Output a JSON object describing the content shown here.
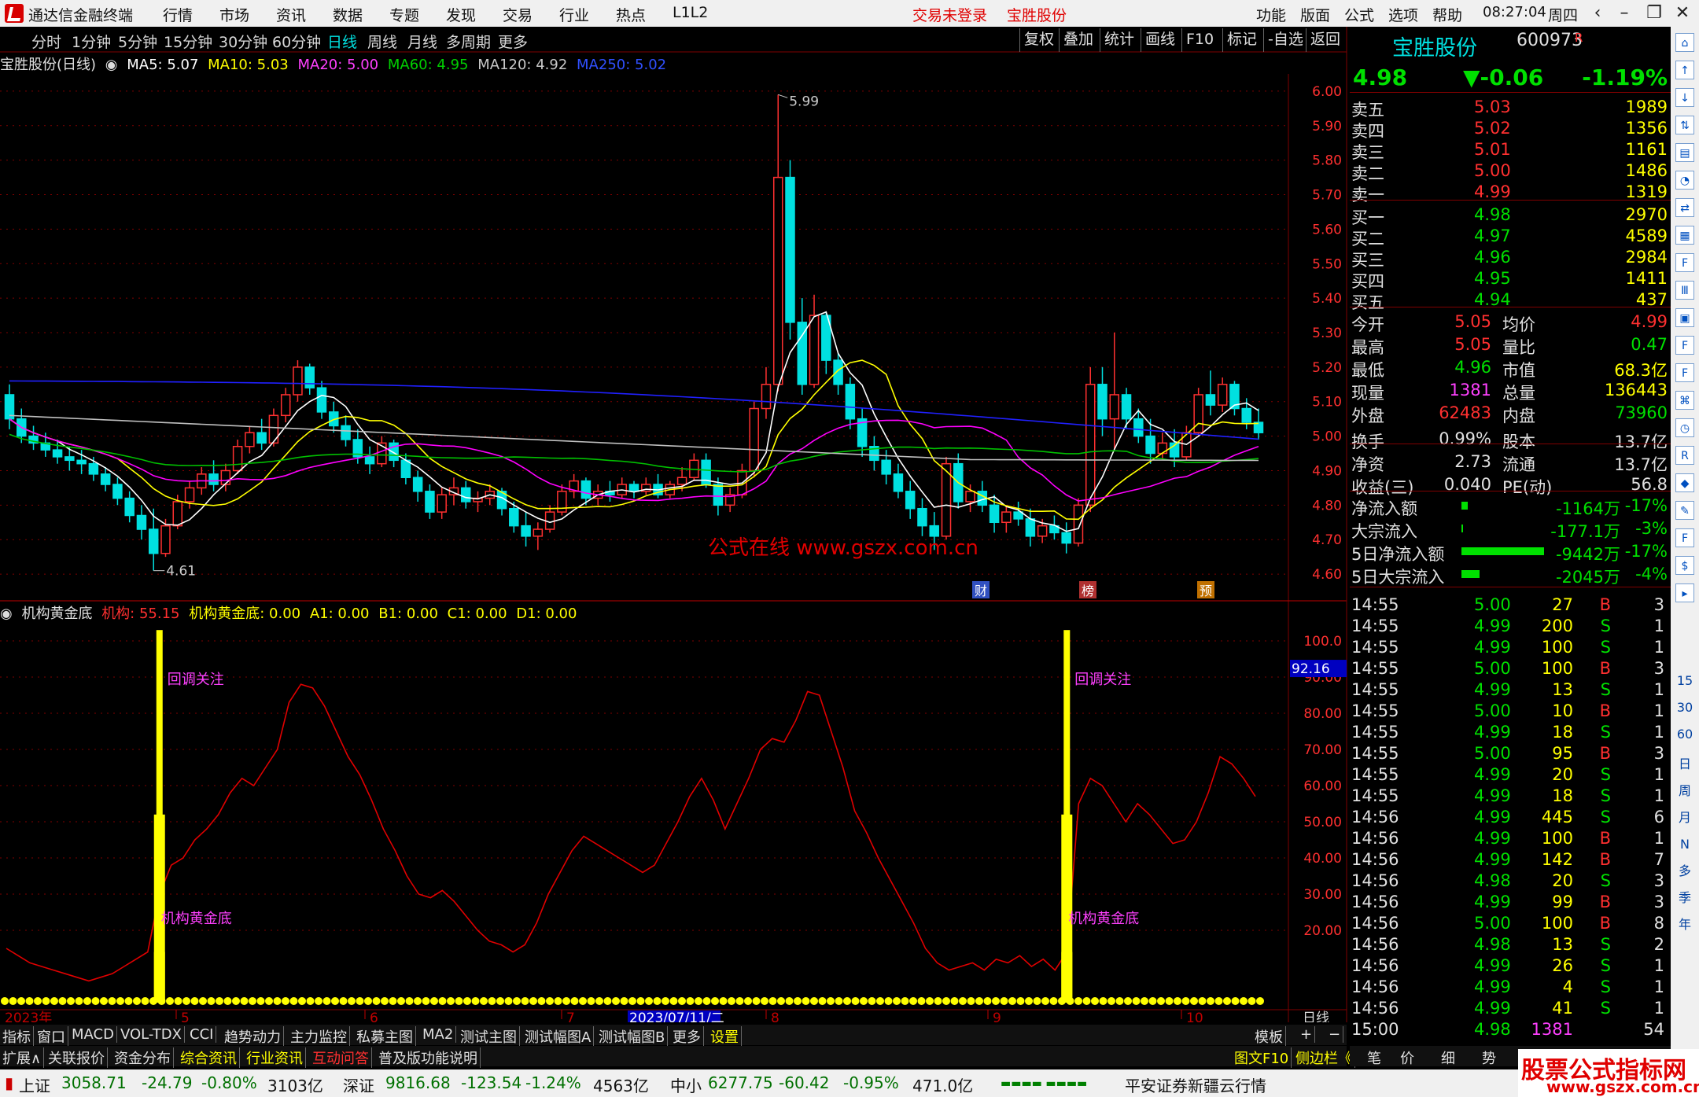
{
  "app": {
    "title": "通达信金融终端",
    "menu": [
      "行情",
      "市场",
      "资讯",
      "数据",
      "专题",
      "发现",
      "交易",
      "行业",
      "热点",
      "L1L2"
    ],
    "login": "交易未登录",
    "stock_link": "宝胜股份",
    "right_menu": [
      "功能",
      "版面",
      "公式",
      "选项",
      "帮助"
    ],
    "time": "08:27:04",
    "weekday": "周四"
  },
  "periods": [
    "分时",
    "1分钟",
    "5分钟",
    "15分钟",
    "30分钟",
    "60分钟",
    "日线",
    "周线",
    "月线",
    "多周期",
    "更多"
  ],
  "active_period": "日线",
  "toolbar": [
    "复权",
    "叠加",
    "统计",
    "画线",
    "F10",
    "标记",
    "-自选",
    "返回"
  ],
  "ma_line": {
    "name": "宝胜股份(日线)",
    "ma5": "MA5: 5.07",
    "ma10": "MA10: 5.03",
    "ma20": "MA20: 5.00",
    "ma60": "MA60: 4.95",
    "ma120": "MA120: 4.92",
    "ma250": "MA250: 5.02"
  },
  "indicator_line": {
    "name": "机构黄金底",
    "jg": "机构: 55.15",
    "jghjd": "机构黄金底: 0.00",
    "a1": "A1: 0.00",
    "b1": "B1: 0.00",
    "c1": "C1: 0.00",
    "d1": "D1: 0.00"
  },
  "colors": {
    "up": "#ff3030",
    "down": "#00e0e0",
    "ma5": "#ffffff",
    "ma10": "#ffff00",
    "ma20": "#ff00ff",
    "ma60": "#00c000",
    "ma120": "#c0c0c0",
    "ma250": "#2020ff",
    "grid": "#800000"
  },
  "price_axis": [
    "6.00",
    "5.90",
    "5.80",
    "5.70",
    "5.60",
    "5.50",
    "5.40",
    "5.30",
    "5.20",
    "5.10",
    "5.00",
    "4.90",
    "4.80",
    "4.70",
    "4.60"
  ],
  "ind_axis": [
    "100.0",
    "90.00",
    "80.00",
    "70.00",
    "60.00",
    "50.00",
    "40.00",
    "30.00",
    "20.00"
  ],
  "ind_cursor": "92.16",
  "hi_label": "5.99",
  "lo_label": "4.61",
  "watermark": "公式在线  www.gszx.com.cn",
  "signals": {
    "callback": "回调关注",
    "bottom": "机构黄金底"
  },
  "event_badges": [
    "财",
    "榜",
    "预"
  ],
  "date_axis": {
    "start": "2023年",
    "months": [
      "5",
      "6",
      "7",
      "8",
      "9",
      "10"
    ],
    "cursor": "2023/07/11/二",
    "period": "日线"
  },
  "quote": {
    "name": "宝胜股份",
    "code": "600973",
    "tag": "R",
    "price": "4.98",
    "change": "▼-0.06",
    "pct": "-1.19%"
  },
  "asks": [
    {
      "l": "卖五",
      "p": "5.03",
      "v": "1989"
    },
    {
      "l": "卖四",
      "p": "5.02",
      "v": "1356"
    },
    {
      "l": "卖三",
      "p": "5.01",
      "v": "1161"
    },
    {
      "l": "卖二",
      "p": "5.00",
      "v": "1486"
    },
    {
      "l": "卖一",
      "p": "4.99",
      "v": "1319"
    }
  ],
  "bids": [
    {
      "l": "买一",
      "p": "4.98",
      "v": "2970"
    },
    {
      "l": "买二",
      "p": "4.97",
      "v": "4589"
    },
    {
      "l": "买三",
      "p": "4.96",
      "v": "2984"
    },
    {
      "l": "买四",
      "p": "4.95",
      "v": "1411"
    },
    {
      "l": "买五",
      "p": "4.94",
      "v": "437"
    }
  ],
  "stats": [
    {
      "l1": "今开",
      "v1": "5.05",
      "l2": "均价",
      "v2": "4.99"
    },
    {
      "l1": "最高",
      "v1": "5.05",
      "l2": "量比",
      "v2": "0.47"
    },
    {
      "l1": "最低",
      "v1": "4.96",
      "l2": "市值",
      "v2": "68.3亿"
    },
    {
      "l1": "现量",
      "v1": "1381",
      "l2": "总量",
      "v2": "136443"
    },
    {
      "l1": "外盘",
      "v1": "62483",
      "l2": "内盘",
      "v2": "73960"
    },
    {
      "l1": "换手",
      "v1": "0.99%",
      "l2": "股本",
      "v2": "13.7亿"
    },
    {
      "l1": "净资",
      "v1": "2.73",
      "l2": "流通",
      "v2": "13.7亿"
    },
    {
      "l1": "收益(三)",
      "v1": "0.040",
      "l2": "PE(动)",
      "v2": "56.8"
    }
  ],
  "flows": [
    {
      "l": "净流入额",
      "v": "-1164万",
      "p": "-17%",
      "bar": 0.04
    },
    {
      "l": "大宗流入",
      "v": "-177.1万",
      "p": "-3%",
      "bar": 0.005
    },
    {
      "l": "5日净流入额",
      "v": "-9442万",
      "p": "-17%",
      "bar": 0.55
    },
    {
      "l": "5日大宗流入",
      "v": "-2045万",
      "p": "-4%",
      "bar": 0.12
    }
  ],
  "ticks": [
    [
      "14:55",
      "5.00",
      "27",
      "B",
      "3"
    ],
    [
      "14:55",
      "4.99",
      "200",
      "S",
      "1"
    ],
    [
      "14:55",
      "4.99",
      "100",
      "S",
      "1"
    ],
    [
      "14:55",
      "5.00",
      "100",
      "B",
      "3"
    ],
    [
      "14:55",
      "4.99",
      "13",
      "S",
      "1"
    ],
    [
      "14:55",
      "5.00",
      "10",
      "B",
      "1"
    ],
    [
      "14:55",
      "4.99",
      "18",
      "S",
      "1"
    ],
    [
      "14:55",
      "5.00",
      "95",
      "B",
      "3"
    ],
    [
      "14:55",
      "4.99",
      "20",
      "S",
      "1"
    ],
    [
      "14:55",
      "4.99",
      "18",
      "S",
      "1"
    ],
    [
      "14:56",
      "4.99",
      "445",
      "S",
      "6"
    ],
    [
      "14:56",
      "4.99",
      "100",
      "B",
      "1"
    ],
    [
      "14:56",
      "4.99",
      "142",
      "B",
      "7"
    ],
    [
      "14:56",
      "4.98",
      "20",
      "S",
      "3"
    ],
    [
      "14:56",
      "4.99",
      "99",
      "B",
      "3"
    ],
    [
      "14:56",
      "5.00",
      "100",
      "B",
      "8"
    ],
    [
      "14:56",
      "4.98",
      "13",
      "S",
      "2"
    ],
    [
      "14:56",
      "4.99",
      "26",
      "S",
      "1"
    ],
    [
      "14:56",
      "4.99",
      "4",
      "S",
      "1"
    ],
    [
      "14:56",
      "4.99",
      "41",
      "S",
      "1"
    ],
    [
      "15:00",
      "4.98",
      "1381",
      "",
      "54"
    ]
  ],
  "ind_tabs": [
    "指标",
    "窗口",
    "MACD",
    "VOL-TDX",
    "CCI",
    "趋势动力",
    "主力监控",
    "私募主图",
    "MA2",
    "测试主图",
    "测试幅图A",
    "测试幅图B",
    "更多",
    "设置"
  ],
  "tabs_right": [
    "模板",
    "+",
    "−"
  ],
  "bottom_tabs": [
    "扩展∧",
    "关联报价",
    "资金分布",
    "综合资讯",
    "行业资讯",
    "互动问答",
    "普及版功能说明"
  ],
  "rbottom": [
    "图文F10",
    "侧边栏《",
    "笔",
    "价",
    "细",
    "势"
  ],
  "status": {
    "sh_name": "上证",
    "sh_val": "3058.71",
    "sh_chg": "-24.79",
    "sh_pct": "-0.80%",
    "sh_amt": "3103亿",
    "sz_name": "深证",
    "sz_val": "9816.68",
    "sz_chg": "-123.54",
    "sz_pct": "-1.24%",
    "sz_amt": "4563亿",
    "zx_name": "中小",
    "zx_val": "6277.75",
    "zx_chg": "-60.42",
    "zx_pct": "-0.95%",
    "zx_amt": "471.0亿",
    "broker": "平安证券新疆云行情"
  },
  "brand": {
    "name": "股票公式指标网",
    "url": "www.gszx.com.cn"
  },
  "side_icons": [
    "日",
    "周",
    "月",
    "N",
    "多",
    "季",
    "年"
  ],
  "side_nums": [
    "15",
    "30",
    "60"
  ],
  "chart_data": [
    {
      "type": "candlestick",
      "title": "宝胜股份(日线)",
      "ylim": [
        4.55,
        6.05
      ],
      "ohlc": [
        [
          5.12,
          5.15,
          5.02,
          5.05
        ],
        [
          5.05,
          5.08,
          4.98,
          5.0
        ],
        [
          5.0,
          5.03,
          4.96,
          4.98
        ],
        [
          4.98,
          5.01,
          4.94,
          4.96
        ],
        [
          4.96,
          4.99,
          4.92,
          4.94
        ],
        [
          4.94,
          4.97,
          4.9,
          4.93
        ],
        [
          4.93,
          4.96,
          4.89,
          4.92
        ],
        [
          4.92,
          4.94,
          4.87,
          4.89
        ],
        [
          4.89,
          4.91,
          4.84,
          4.86
        ],
        [
          4.86,
          4.88,
          4.8,
          4.82
        ],
        [
          4.82,
          4.84,
          4.75,
          4.77
        ],
        [
          4.77,
          4.8,
          4.7,
          4.73
        ],
        [
          4.73,
          4.79,
          4.61,
          4.66
        ],
        [
          4.66,
          4.76,
          4.65,
          4.74
        ],
        [
          4.74,
          4.83,
          4.73,
          4.81
        ],
        [
          4.81,
          4.87,
          4.79,
          4.85
        ],
        [
          4.85,
          4.91,
          4.83,
          4.89
        ],
        [
          4.89,
          4.93,
          4.84,
          4.86
        ],
        [
          4.86,
          4.92,
          4.84,
          4.9
        ],
        [
          4.9,
          4.99,
          4.89,
          4.97
        ],
        [
          4.97,
          5.03,
          4.95,
          5.01
        ],
        [
          5.01,
          5.05,
          4.96,
          4.98
        ],
        [
          4.98,
          5.08,
          4.97,
          5.06
        ],
        [
          5.06,
          5.14,
          5.04,
          5.12
        ],
        [
          5.12,
          5.22,
          5.1,
          5.2
        ],
        [
          5.2,
          5.21,
          5.12,
          5.14
        ],
        [
          5.14,
          5.16,
          5.05,
          5.07
        ],
        [
          5.07,
          5.1,
          5.01,
          5.03
        ],
        [
          5.03,
          5.06,
          4.97,
          4.99
        ],
        [
          4.99,
          5.02,
          4.92,
          4.94
        ],
        [
          4.94,
          4.97,
          4.89,
          4.92
        ],
        [
          4.92,
          5.0,
          4.91,
          4.98
        ],
        [
          4.98,
          4.99,
          4.91,
          4.93
        ],
        [
          4.93,
          4.95,
          4.86,
          4.88
        ],
        [
          4.88,
          4.9,
          4.81,
          4.84
        ],
        [
          4.84,
          4.86,
          4.76,
          4.78
        ],
        [
          4.78,
          4.85,
          4.76,
          4.83
        ],
        [
          4.83,
          4.88,
          4.8,
          4.85
        ],
        [
          4.85,
          4.87,
          4.79,
          4.81
        ],
        [
          4.81,
          4.84,
          4.78,
          4.82
        ],
        [
          4.82,
          4.86,
          4.8,
          4.84
        ],
        [
          4.84,
          4.85,
          4.77,
          4.79
        ],
        [
          4.79,
          4.81,
          4.72,
          4.74
        ],
        [
          4.74,
          4.78,
          4.68,
          4.71
        ],
        [
          4.71,
          4.75,
          4.67,
          4.73
        ],
        [
          4.73,
          4.8,
          4.72,
          4.78
        ],
        [
          4.78,
          4.86,
          4.77,
          4.84
        ],
        [
          4.84,
          4.89,
          4.82,
          4.87
        ],
        [
          4.87,
          4.88,
          4.8,
          4.82
        ],
        [
          4.82,
          4.86,
          4.8,
          4.84
        ],
        [
          4.84,
          4.87,
          4.81,
          4.83
        ],
        [
          4.83,
          4.88,
          4.82,
          4.86
        ],
        [
          4.86,
          4.87,
          4.82,
          4.84
        ],
        [
          4.84,
          4.88,
          4.83,
          4.86
        ],
        [
          4.86,
          4.89,
          4.82,
          4.83
        ],
        [
          4.83,
          4.87,
          4.82,
          4.86
        ],
        [
          4.86,
          4.91,
          4.84,
          4.88
        ],
        [
          4.88,
          4.95,
          4.87,
          4.93
        ],
        [
          4.93,
          4.95,
          4.85,
          4.86
        ],
        [
          4.86,
          4.88,
          4.77,
          4.8
        ],
        [
          4.8,
          4.85,
          4.78,
          4.83
        ],
        [
          4.83,
          4.92,
          4.82,
          4.9
        ],
        [
          4.9,
          5.1,
          4.88,
          5.08
        ],
        [
          5.08,
          5.2,
          5.05,
          5.15
        ],
        [
          5.15,
          5.99,
          5.13,
          5.75
        ],
        [
          5.75,
          5.8,
          5.28,
          5.33
        ],
        [
          5.33,
          5.4,
          5.12,
          5.15
        ],
        [
          5.15,
          5.41,
          5.14,
          5.35
        ],
        [
          5.35,
          5.36,
          5.18,
          5.22
        ],
        [
          5.22,
          5.24,
          5.12,
          5.15
        ],
        [
          5.15,
          5.17,
          5.02,
          5.05
        ],
        [
          5.05,
          5.08,
          4.94,
          4.97
        ],
        [
          4.97,
          5.0,
          4.9,
          4.93
        ],
        [
          4.93,
          4.96,
          4.86,
          4.89
        ],
        [
          4.89,
          4.92,
          4.82,
          4.84
        ],
        [
          4.84,
          4.87,
          4.76,
          4.79
        ],
        [
          4.79,
          4.82,
          4.71,
          4.74
        ],
        [
          4.74,
          4.78,
          4.67,
          4.71
        ],
        [
          4.71,
          4.94,
          4.7,
          4.92
        ],
        [
          4.92,
          4.95,
          4.79,
          4.81
        ],
        [
          4.81,
          4.86,
          4.78,
          4.84
        ],
        [
          4.84,
          4.87,
          4.78,
          4.8
        ],
        [
          4.8,
          4.83,
          4.72,
          4.75
        ],
        [
          4.75,
          4.8,
          4.72,
          4.78
        ],
        [
          4.78,
          4.81,
          4.74,
          4.76
        ],
        [
          4.76,
          4.79,
          4.68,
          4.71
        ],
        [
          4.71,
          4.76,
          4.69,
          4.74
        ],
        [
          4.74,
          4.77,
          4.7,
          4.72
        ],
        [
          4.72,
          4.75,
          4.66,
          4.69
        ],
        [
          4.69,
          4.82,
          4.68,
          4.8
        ],
        [
          4.8,
          5.2,
          4.78,
          5.15
        ],
        [
          5.15,
          5.2,
          5.0,
          5.05
        ],
        [
          5.05,
          5.3,
          4.96,
          5.12
        ],
        [
          5.12,
          5.14,
          5.02,
          5.05
        ],
        [
          5.05,
          5.08,
          4.98,
          5.0
        ],
        [
          5.0,
          5.05,
          4.92,
          4.95
        ],
        [
          4.95,
          5.01,
          4.93,
          4.98
        ],
        [
          4.98,
          5.02,
          4.91,
          4.94
        ],
        [
          4.94,
          5.03,
          4.93,
          5.01
        ],
        [
          5.01,
          5.14,
          5.0,
          5.12
        ],
        [
          5.12,
          5.19,
          5.06,
          5.09
        ],
        [
          5.09,
          5.17,
          5.07,
          5.15
        ],
        [
          5.15,
          5.16,
          5.06,
          5.08
        ],
        [
          5.08,
          5.11,
          5.02,
          5.04
        ],
        [
          5.04,
          5.08,
          4.99,
          5.01
        ]
      ],
      "ma": {
        "MA5": "5.07",
        "MA10": "5.03",
        "MA20": "5.00",
        "MA60": "4.95",
        "MA120": "4.92",
        "MA250": "5.02"
      }
    },
    {
      "type": "line",
      "title": "机构黄金底",
      "ylim": [
        0,
        105
      ],
      "series": [
        {
          "name": "机构",
          "values": [
            15,
            13,
            11,
            10,
            9,
            8,
            7,
            6,
            7,
            8,
            10,
            12,
            14,
            30,
            38,
            40,
            45,
            48,
            52,
            58,
            62,
            60,
            65,
            70,
            83,
            88,
            87,
            82,
            75,
            68,
            63,
            56,
            48,
            42,
            35,
            30,
            29,
            31,
            28,
            24,
            20,
            17,
            16,
            14,
            16,
            22,
            30,
            36,
            42,
            46,
            44,
            42,
            40,
            38,
            36,
            38,
            44,
            50,
            57,
            62,
            56,
            48,
            55,
            62,
            70,
            73,
            72,
            78,
            86,
            85,
            75,
            65,
            53,
            47,
            40,
            34,
            28,
            22,
            15,
            11,
            9,
            10,
            11,
            9,
            12,
            11,
            13,
            10,
            12,
            9,
            14,
            55,
            62,
            60,
            55,
            50,
            55,
            52,
            48,
            44,
            45,
            50,
            58,
            68,
            66,
            62,
            57
          ]
        },
        {
          "name": "机构黄金底",
          "values": []
        }
      ],
      "signals": [
        13,
        90
      ]
    }
  ]
}
